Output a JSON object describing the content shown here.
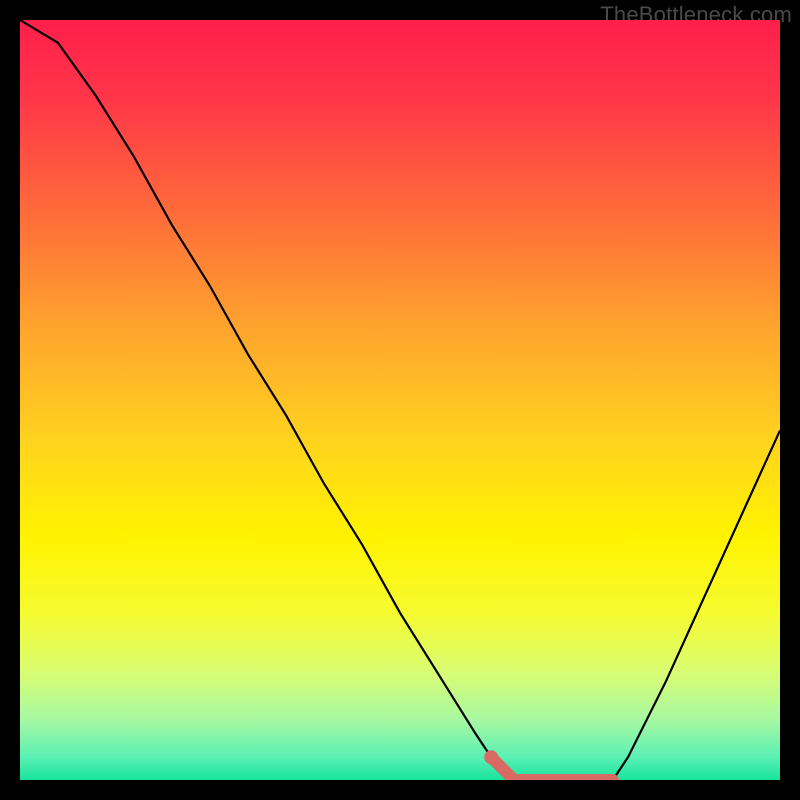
{
  "watermark": "TheBottleneck.com",
  "chart_data": {
    "type": "line",
    "title": "",
    "xlabel": "",
    "ylabel": "",
    "xlim": [
      0,
      100
    ],
    "ylim": [
      0,
      100
    ],
    "series": [
      {
        "name": "bottleneck-curve",
        "x": [
          0,
          5,
          10,
          15,
          20,
          25,
          30,
          35,
          40,
          45,
          50,
          55,
          60,
          62,
          65,
          70,
          75,
          78,
          80,
          85,
          90,
          95,
          100
        ],
        "values": [
          100,
          97,
          90,
          82,
          73,
          65,
          56,
          48,
          39,
          31,
          22,
          14,
          6,
          3,
          0,
          0,
          0,
          0,
          3,
          13,
          24,
          35,
          46
        ]
      }
    ],
    "highlight": {
      "name": "optimal-range",
      "x": [
        62,
        65,
        70,
        75,
        78
      ],
      "values": [
        3,
        0,
        0,
        0,
        0
      ]
    },
    "gradient_stops": [
      {
        "offset": 0.0,
        "color": "#ff1f4b"
      },
      {
        "offset": 0.1,
        "color": "#ff3549"
      },
      {
        "offset": 0.25,
        "color": "#ff6a3a"
      },
      {
        "offset": 0.4,
        "color": "#ffa22e"
      },
      {
        "offset": 0.55,
        "color": "#ffd21f"
      },
      {
        "offset": 0.68,
        "color": "#fff300"
      },
      {
        "offset": 0.78,
        "color": "#f6fb2f"
      },
      {
        "offset": 0.86,
        "color": "#d8fc74"
      },
      {
        "offset": 0.92,
        "color": "#a8f9a2"
      },
      {
        "offset": 0.97,
        "color": "#5af0b4"
      },
      {
        "offset": 1.0,
        "color": "#18e39e"
      }
    ],
    "colors": {
      "curve": "#000000",
      "highlight": "#d96a63"
    }
  }
}
